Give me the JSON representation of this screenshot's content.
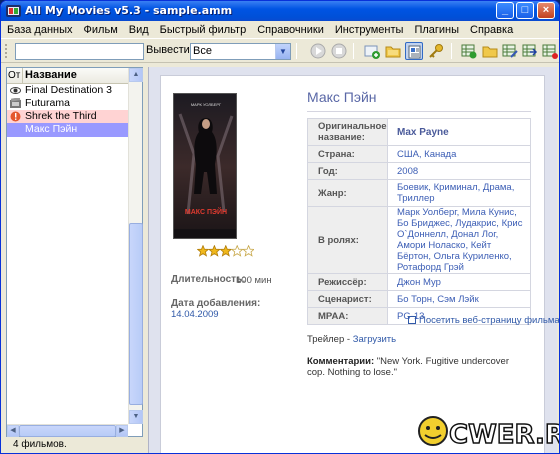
{
  "window": {
    "title": "All My Movies v5.3 - sample.amm",
    "controls": {
      "minimize": "_",
      "maximize": "□",
      "close": "×"
    }
  },
  "menu": [
    {
      "label": "База данных"
    },
    {
      "label": "Фильм"
    },
    {
      "label": "Вид"
    },
    {
      "label": "Быстрый фильтр"
    },
    {
      "label": "Справочники"
    },
    {
      "label": "Инструменты"
    },
    {
      "label": "Плагины"
    },
    {
      "label": "Справка"
    }
  ],
  "toolbar": {
    "search_value": "",
    "show_label": "Вывести",
    "filter_value": "Все"
  },
  "list": {
    "col_icon_header": "От",
    "col_name_header": "Название",
    "items": [
      {
        "title": "Final Destination 3",
        "icon": "eye-icon",
        "state": "normal"
      },
      {
        "title": "Futurama",
        "icon": "film-icon",
        "state": "normal"
      },
      {
        "title": "Shrek the Third",
        "icon": "warning-icon",
        "state": "highlight"
      },
      {
        "title": "Макс Пэйн",
        "icon": "",
        "state": "selected"
      }
    ]
  },
  "status": {
    "text": "4 фильмов."
  },
  "movie": {
    "title": "Макс Пэйн",
    "poster": {
      "actor": "МАРК УОЛБЕРГ",
      "title": "МАКС ПЭЙН"
    },
    "rating": 3,
    "rating_max": 5,
    "duration_label": "Длительность:",
    "duration_value": "100 мин",
    "added_label": "Дата добавления:",
    "added_value": "14.04.2009",
    "fields": [
      {
        "label": "Оригинальное название:",
        "value": "Max Payne",
        "style": "strong"
      },
      {
        "label": "Страна:",
        "value": "США, Канада"
      },
      {
        "label": "Год:",
        "value": "2008"
      },
      {
        "label": "Жанр:",
        "value": "Боевик, Криминал, Драма, Триллер"
      },
      {
        "label": "В ролях:",
        "value": "Марк Уолберг, Мила Кунис, Бо Бриджес, Лудакрис, Крис О`Доннелл, Донал Лог, Амори Ноласко, Кейт Бёртон, Ольга Куриленко, Ротафорд Грэй"
      },
      {
        "label": "Режиссёр:",
        "value": "Джон Мур"
      },
      {
        "label": "Сценарист:",
        "value": "Бо Торн, Сэм Лэйк"
      },
      {
        "label": "MPAA:",
        "value": "PG-13"
      }
    ],
    "website_label": "Посетить веб-страницу фильма",
    "trailer_label": "Трейлер - ",
    "trailer_link": "Загрузить",
    "comment_label": "Комментарии:",
    "comment_text": "\"New York. Fugitive undercover cop. Nothing to lose.\""
  },
  "watermark": {
    "text": "CWER.RU"
  },
  "colors": {
    "title_bar": "#0054e3",
    "selected_row": "#9999ff",
    "highlight_row": "#ffd3d3",
    "link": "#3059a8",
    "movie_title": "#5967a6",
    "panel_bg": "#dfe2ee"
  }
}
